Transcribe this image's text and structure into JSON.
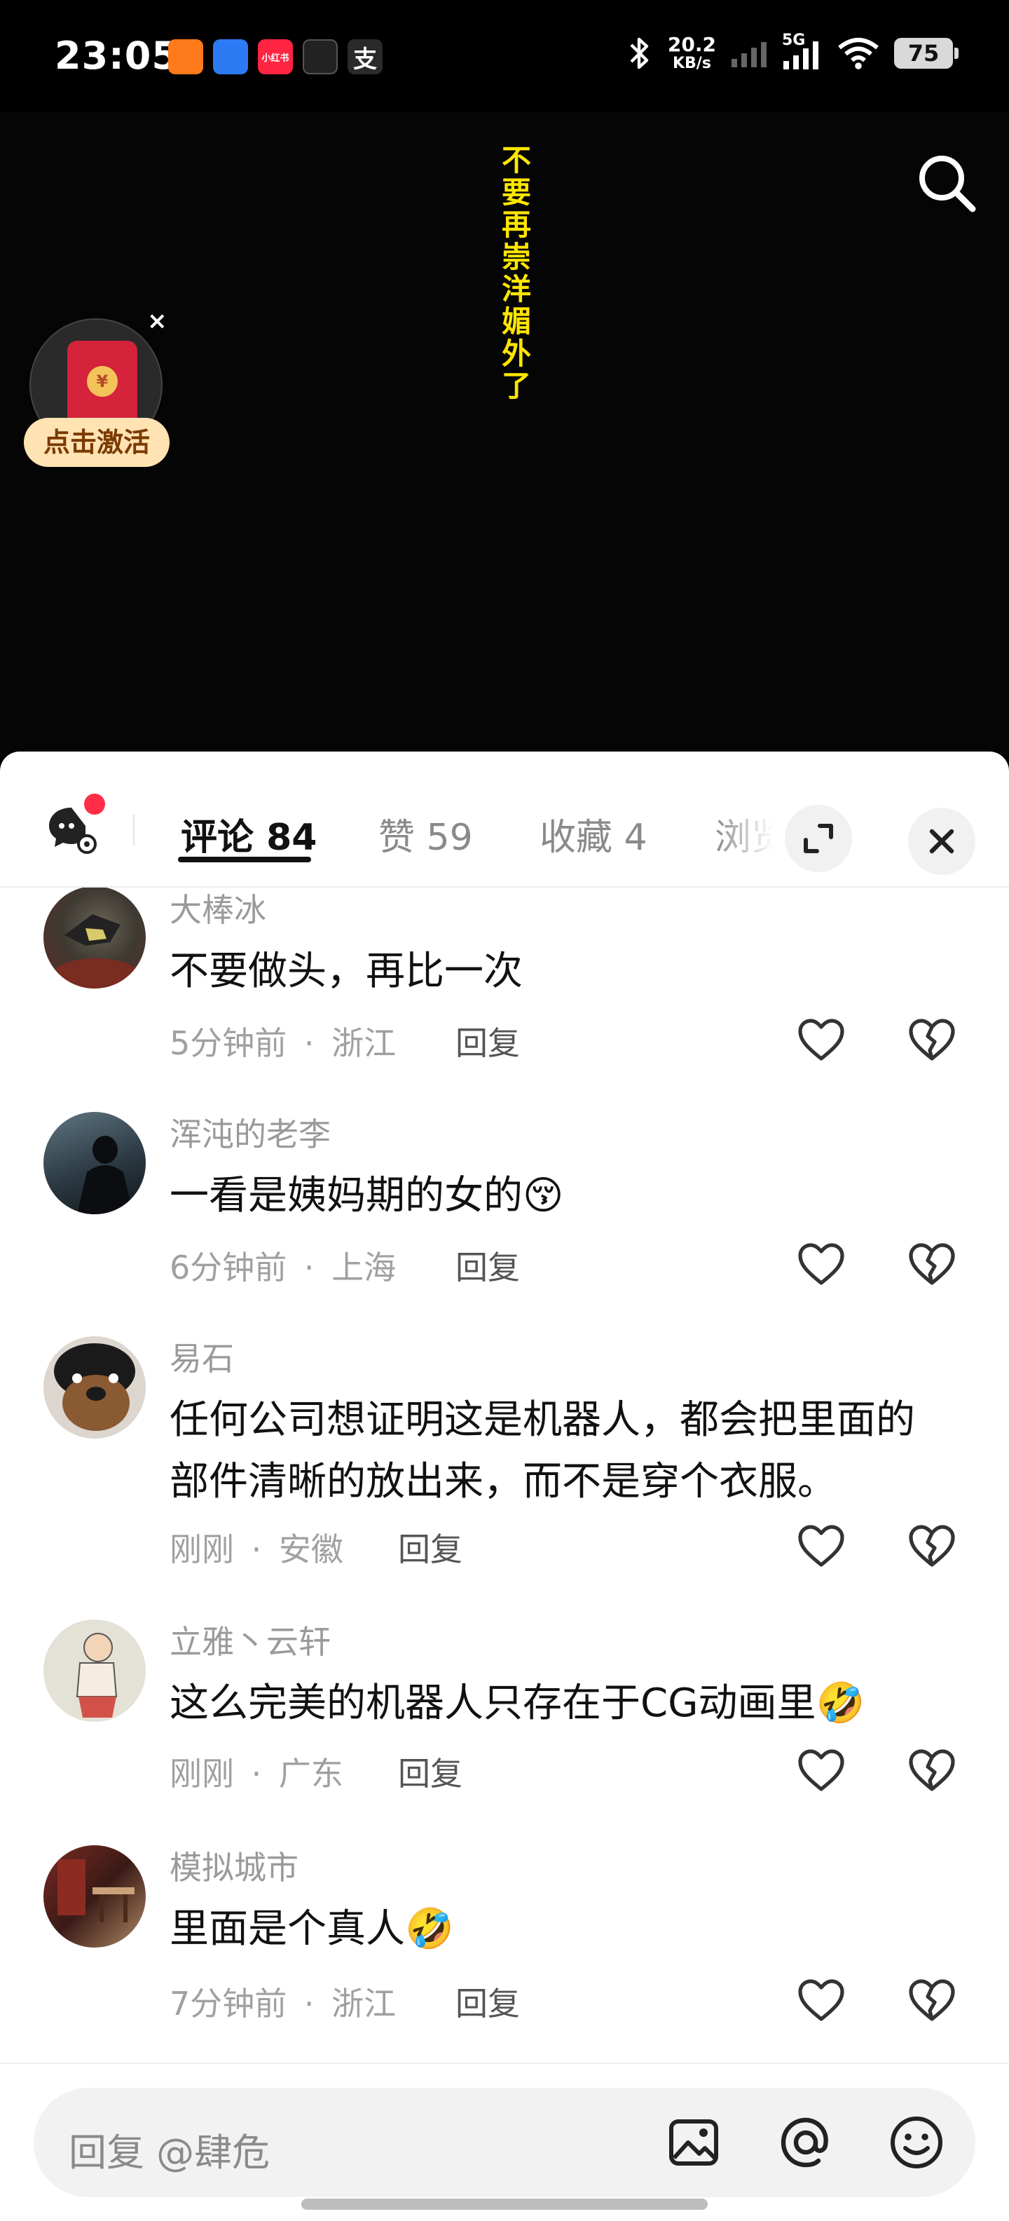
{
  "status_bar": {
    "time": "23:05",
    "app_icons": [
      {
        "name": "video-app-icon",
        "label": "",
        "color": "#ff7a1a"
      },
      {
        "name": "cloud-app-icon",
        "label": "",
        "color": "#2d7bf4"
      },
      {
        "name": "xiaohongshu-app-icon",
        "label": "小红书",
        "color": "#ff2442"
      },
      {
        "name": "cross-app-icon",
        "label": "",
        "color": "#222222"
      },
      {
        "name": "alipay-app-icon",
        "label": "支",
        "color": "#2a2a2a"
      }
    ],
    "net_speed": "20.2",
    "net_unit": "KB/s",
    "signal_label": "5G",
    "battery": "75"
  },
  "video": {
    "caption": "不要再崇洋媚外了",
    "redpacket": {
      "label": "点击激活",
      "coin": "¥",
      "close": "×"
    }
  },
  "sheet": {
    "tabs": [
      {
        "label": "评论 84",
        "active": true
      },
      {
        "label": "赞 59",
        "active": false
      },
      {
        "label": "收藏 4",
        "active": false
      },
      {
        "label": "浏览",
        "active": false
      }
    ],
    "comments": [
      {
        "name": "大棒冰",
        "text": "不要做头，再比一次",
        "time": "5分钟前",
        "location": "浙江",
        "reply": "回复"
      },
      {
        "name": "浑沌的老李",
        "text": "一看是姨妈期的女的",
        "emoji": "😚",
        "time": "6分钟前",
        "location": "上海",
        "reply": "回复"
      },
      {
        "name": "易石",
        "text": "任何公司想证明这是机器人，都会把里面的部件清晰的放出来，而不是穿个衣服。",
        "time": "刚刚",
        "location": "安徽",
        "reply": "回复"
      },
      {
        "name": "立雅丶云轩",
        "text": "这么完美的机器人只存在于CG动画里",
        "emoji": "🤣",
        "time": "刚刚",
        "location": "广东",
        "reply": "回复"
      },
      {
        "name": "模拟城市",
        "text": "里面是个真人",
        "emoji": "🤣",
        "time": "7分钟前",
        "location": "浙江",
        "reply": "回复"
      }
    ],
    "separator": "·",
    "input_placeholder": "回复 @肆危"
  },
  "colors": {
    "accent_red": "#ff2d48",
    "caption_yellow": "#ffe600",
    "redpacket": "#d4233a"
  }
}
